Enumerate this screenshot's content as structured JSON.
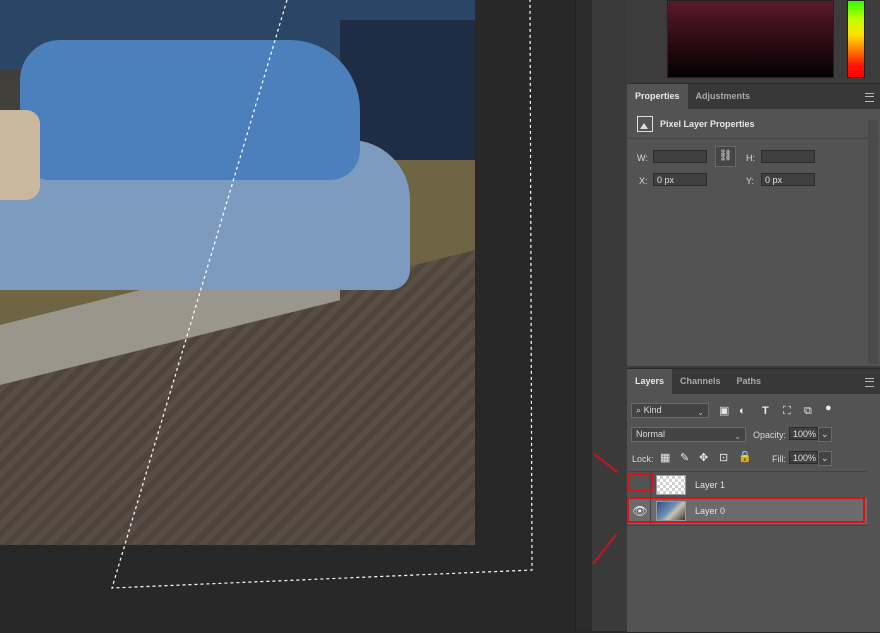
{
  "properties": {
    "tabs": [
      "Properties",
      "Adjustments"
    ],
    "title": "Pixel Layer Properties",
    "w_label": "W:",
    "h_label": "H:",
    "x_label": "X:",
    "x_value": "0 px",
    "y_label": "Y:",
    "y_value": "0 px"
  },
  "layers": {
    "tabs": [
      "Layers",
      "Channels",
      "Paths"
    ],
    "filter_kind": "Kind",
    "blend_mode": "Normal",
    "opacity_label": "Opacity:",
    "opacity_value": "100%",
    "lock_label": "Lock:",
    "fill_label": "Fill:",
    "fill_value": "100%",
    "items": [
      {
        "name": "Layer 1",
        "visible": false
      },
      {
        "name": "Layer 0",
        "visible": true,
        "selected": true
      }
    ]
  },
  "icons": {
    "panel_menu": "panel-menu-icon",
    "link": "link-icon",
    "search": "search-icon",
    "eye": "eye-icon"
  },
  "colors": {
    "highlight": "#d8141a",
    "selected_layer": "#6b6b6b"
  }
}
